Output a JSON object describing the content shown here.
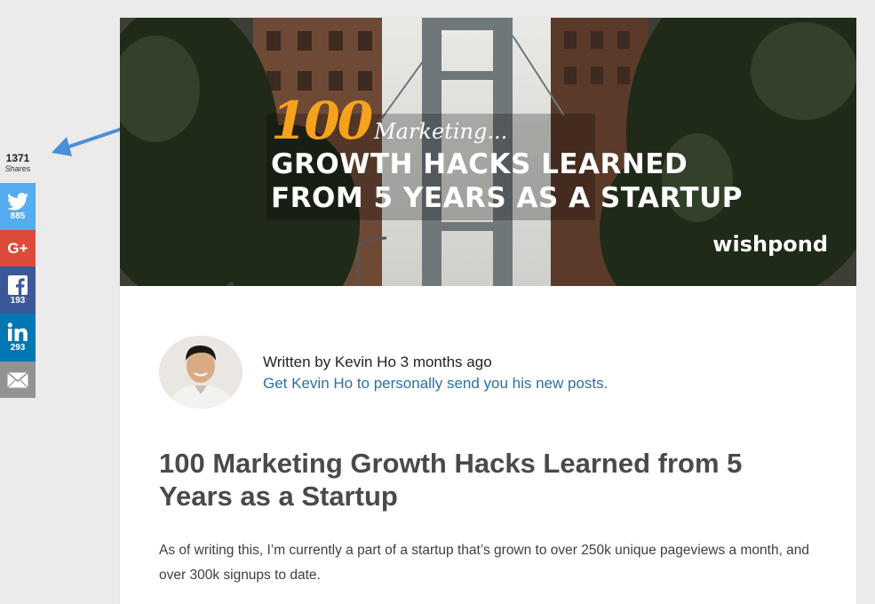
{
  "share": {
    "total": "1371",
    "total_label": "Shares",
    "twitter_count": "885",
    "googleplus_glyph": "G+",
    "facebook_count": "193",
    "linkedin_count": "293"
  },
  "hero": {
    "number": "100",
    "script_word": "Marketing...",
    "line1": "GROWTH HACKS LEARNED",
    "line2": "FROM 5 YEARS AS A STARTUP",
    "brand": "wishpond"
  },
  "author": {
    "byline": "Written by Kevin Ho 3 months ago",
    "follow_link": "Get Kevin Ho to personally send you his new posts."
  },
  "article": {
    "title": "100 Marketing Growth Hacks Learned from 5 Years as a Startup",
    "intro": "As of writing this, I’m currently a part of a startup that’s grown to over 250k unique pageviews a month, and over 300k signups to date."
  },
  "colors": {
    "twitter": "#55acee",
    "googleplus": "#dd4b39",
    "facebook": "#3b5998",
    "linkedin": "#0077b5",
    "email": "#929292",
    "link": "#2d6fa6",
    "hero_accent": "#f7a21b"
  }
}
